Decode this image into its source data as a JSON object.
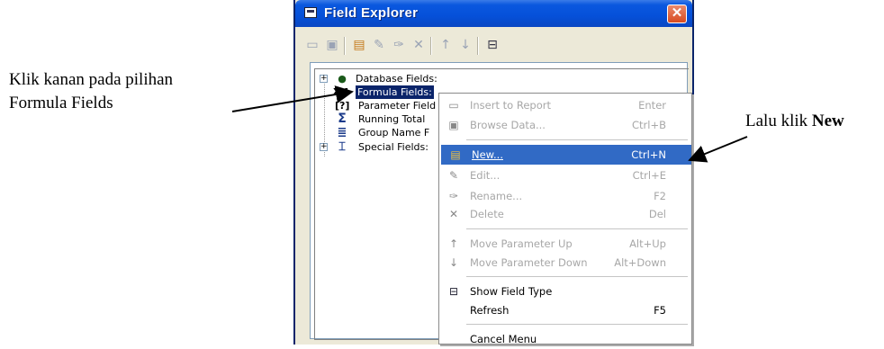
{
  "annotations": {
    "left_line1": "Klik kanan pada pilihan",
    "left_line2": "Formula Fields",
    "right_prefix": "Lalu klik ",
    "right_bold": "New"
  },
  "window": {
    "title": "Field Explorer",
    "close_label": "✕"
  },
  "tree": [
    {
      "label": "Database Fields:",
      "expandable": true
    },
    {
      "label": "Formula Fields:",
      "selected": true
    },
    {
      "label": "Parameter Field"
    },
    {
      "label": "Running Total"
    },
    {
      "label": "Group Name F"
    },
    {
      "label": "Special Fields:",
      "expandable": true
    }
  ],
  "menu": {
    "items": [
      {
        "label": "Insert to Report",
        "shortcut": "Enter",
        "disabled": true
      },
      {
        "label": "Browse Data...",
        "shortcut": "Ctrl+B",
        "disabled": true
      },
      {
        "label": "New...",
        "shortcut": "Ctrl+N",
        "highlighted": true
      },
      {
        "label": "Edit...",
        "shortcut": "Ctrl+E",
        "disabled": true
      },
      {
        "label": "Rename...",
        "shortcut": "F2",
        "disabled": true
      },
      {
        "label": "Delete",
        "shortcut": "Del",
        "disabled": true
      },
      {
        "label": "Move Parameter Up",
        "shortcut": "Alt+Up",
        "disabled": true
      },
      {
        "label": "Move Parameter Down",
        "shortcut": "Alt+Down",
        "disabled": true
      },
      {
        "label": "Show Field Type",
        "shortcut": ""
      },
      {
        "label": "Refresh",
        "shortcut": "F5"
      },
      {
        "label": "Cancel Menu",
        "shortcut": ""
      }
    ]
  },
  "colors": {
    "titlebar": "#0550d9",
    "highlight": "#316ac5",
    "selection": "#0a246a"
  }
}
